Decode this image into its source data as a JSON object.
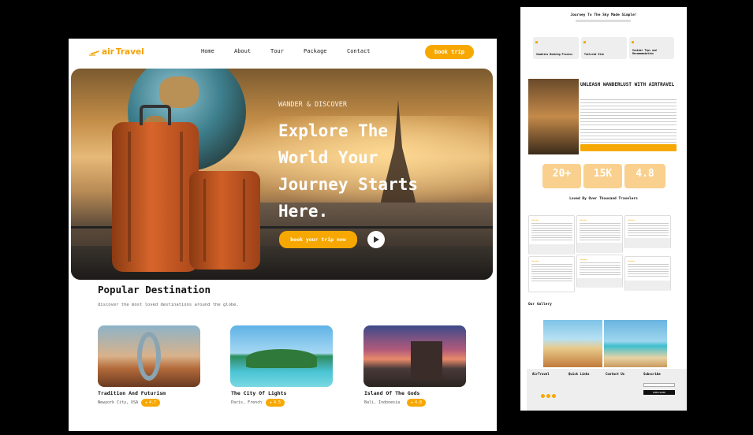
{
  "nav": {
    "logo_air": "air",
    "logo_travel": "Travel",
    "links": [
      "Home",
      "About",
      "Tour",
      "Package",
      "Contact"
    ],
    "cta": "book trip"
  },
  "hero": {
    "kicker": "WANDER & DISCOVER",
    "title_lines": [
      "Explore The",
      "World Your",
      "Journey Starts",
      "Here."
    ],
    "cta": "book your trip now"
  },
  "popular": {
    "title": "Popular Destination",
    "subtitle": "discover the most loved destinations around the globe.",
    "cards": [
      {
        "name": "Tradition And Futurism",
        "location": "Newyork City, USA",
        "rating": "4.7"
      },
      {
        "name": "The City Of Lights",
        "location": "Paris, French",
        "rating": "4.5"
      },
      {
        "name": "Island Of The Gods",
        "location": "Bali, Indonesia",
        "rating": "4.8"
      }
    ]
  },
  "side": {
    "title": "Journey To The Sky Made Simple!",
    "features": [
      "Seamless Booking Process",
      "Tailored Itin",
      "Insider Tips and Recommendation"
    ],
    "about_title": "UNLEASH WANDERLUST WITH AIRTRAVEL",
    "stats": [
      "20+",
      "15K",
      "4.8"
    ],
    "loved_title": "Loved By Over Thousand Travelers",
    "gallery_title": "Our Gallery",
    "footer": {
      "brand": "AirTravel",
      "quick_links": "Quick Links",
      "contact": "Contact Us",
      "subscribe": "Subscribe",
      "subscribe_btn": "SUBSCRIBE"
    }
  },
  "colors": {
    "accent": "#f7a800",
    "stat": "#f9d08e"
  }
}
